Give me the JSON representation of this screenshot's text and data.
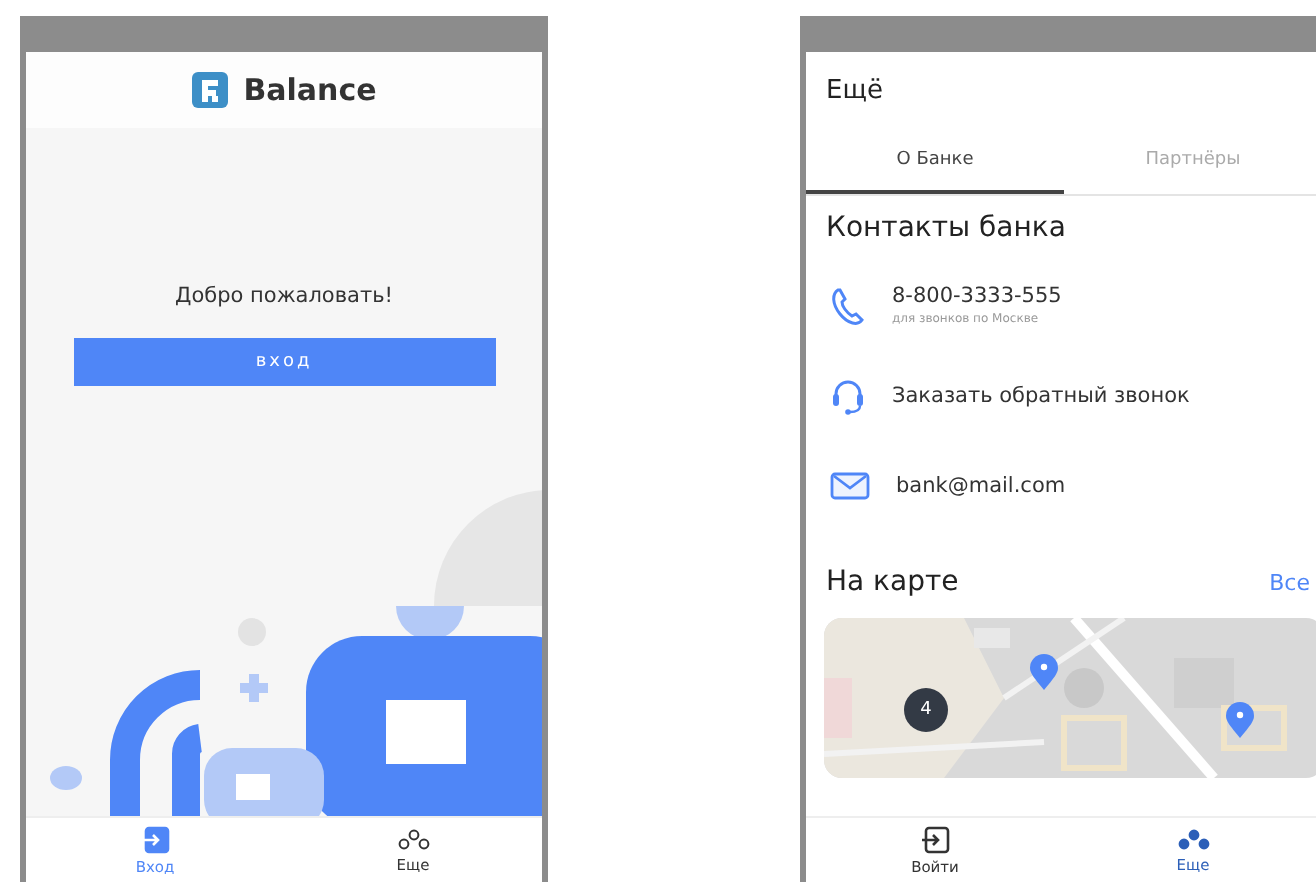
{
  "login_screen": {
    "app_name": "Balance",
    "welcome": "Добро пожаловать!",
    "login_button": "вход",
    "nav": [
      {
        "label": "Вход",
        "selected": true
      },
      {
        "label": "Еще",
        "selected": false
      }
    ]
  },
  "more_screen": {
    "title": "Ещё",
    "tabs": [
      {
        "label": "О Банке",
        "selected": true
      },
      {
        "label": "Партнёры",
        "selected": false
      }
    ],
    "contacts_title": "Контакты банка",
    "contacts": [
      {
        "kind": "phone",
        "text": "8-800-3333-555",
        "note": "для звонков по Москве"
      },
      {
        "kind": "callback",
        "text": "Заказать обратный звонок"
      },
      {
        "kind": "email",
        "text": "bank@mail.com"
      }
    ],
    "map_title": "На карте",
    "map_link": "Все",
    "map_cluster": "4",
    "nav": [
      {
        "label": "Войти",
        "selected": false
      },
      {
        "label": "Еще",
        "selected": true
      }
    ]
  }
}
